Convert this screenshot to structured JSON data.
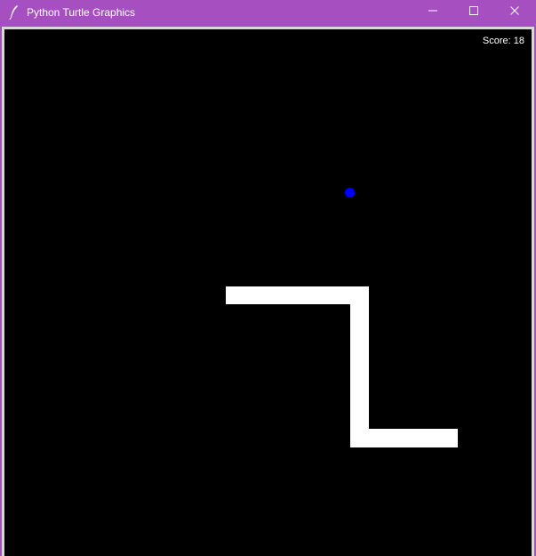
{
  "window": {
    "title": "Python Turtle Graphics",
    "titlebar_color": "#a64fc0"
  },
  "game": {
    "score_text": "Score: 18",
    "background_color": "#000000",
    "snake_color": "#ffffff",
    "food_color": "#0000ff"
  },
  "icons": {
    "app": "feather-icon",
    "minimize": "minimize-icon",
    "maximize": "maximize-icon",
    "close": "close-icon"
  }
}
